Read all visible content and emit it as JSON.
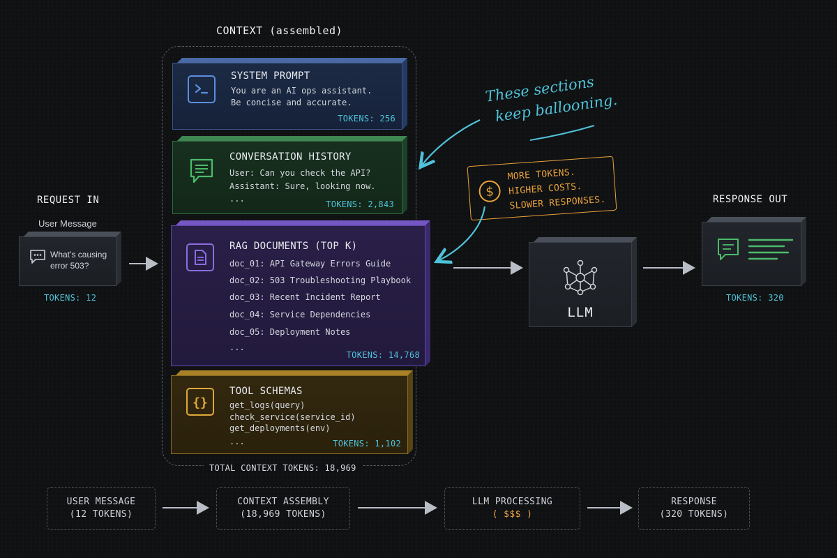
{
  "context": {
    "title": "CONTEXT (assembled)",
    "total": "TOTAL CONTEXT TOKENS: 18,969",
    "sections": {
      "system": {
        "title": "SYSTEM PROMPT",
        "lines": [
          "You are an AI ops assistant.",
          "Be concise and accurate."
        ],
        "tokens": "TOKENS: 256",
        "icon": "terminal-icon",
        "color": "#5b8fe0"
      },
      "history": {
        "title": "CONVERSATION HISTORY",
        "lines": [
          "User: Can you check the API?",
          "Assistant: Sure, looking now.",
          "..."
        ],
        "tokens": "TOKENS: 2,843",
        "icon": "chat-icon",
        "color": "#4cbb6b"
      },
      "rag": {
        "title": "RAG DOCUMENTS (TOP K)",
        "lines": [
          "doc_01: API Gateway Errors Guide",
          "doc_02: 503 Troubleshooting Playbook",
          "doc_03: Recent Incident Report",
          "doc_04: Service Dependencies",
          "doc_05: Deployment Notes",
          "..."
        ],
        "tokens": "TOKENS: 14,768",
        "icon": "document-icon",
        "color": "#8a6ee0"
      },
      "tools": {
        "title": "TOOL SCHEMAS",
        "lines": [
          "get_logs(query)",
          "check_service(service_id)",
          "get_deployments(env)",
          "..."
        ],
        "tokens": "TOKENS: 1,102",
        "icon": "braces-icon",
        "color": "#e0a83a"
      }
    }
  },
  "request": {
    "heading": "REQUEST IN",
    "sub": "User Message",
    "message_lines": [
      "What’s causing",
      "error 503?"
    ],
    "tokens": "TOKENS: 12"
  },
  "llm": {
    "label": "LLM",
    "icon": "network-icon"
  },
  "response": {
    "heading": "RESPONSE OUT",
    "tokens": "TOKENS: 320"
  },
  "annotations": {
    "ballooning": [
      "These sections",
      "keep ballooning."
    ],
    "costs": [
      "MORE TOKENS.",
      "HIGHER COSTS.",
      "SLOWER RESPONSES."
    ],
    "accent_cyan": "#4fc3d9",
    "accent_orange": "#e8a33a"
  },
  "flow": [
    [
      "USER MESSAGE",
      "(12 TOKENS)"
    ],
    [
      "CONTEXT ASSEMBLY",
      "(18,969 TOKENS)"
    ],
    [
      "LLM PROCESSING",
      "( $$$ )"
    ],
    [
      "RESPONSE",
      "(320 TOKENS)"
    ]
  ]
}
